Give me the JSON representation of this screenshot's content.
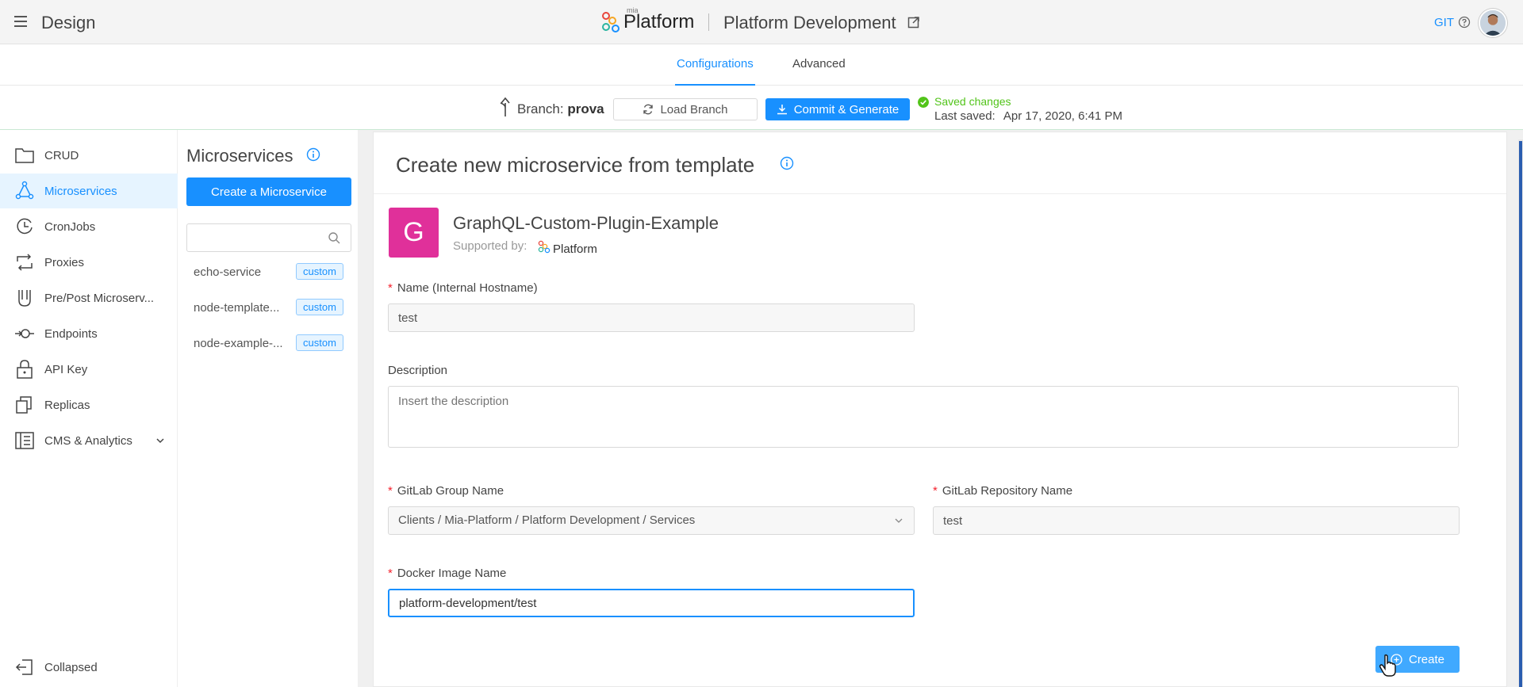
{
  "header": {
    "app_title": "Design",
    "logo_small": "mia",
    "logo_text": "Platform",
    "project_name": "Platform Development",
    "git_label": "GIT"
  },
  "tabs": [
    {
      "label": "Configurations",
      "active": true
    },
    {
      "label": "Advanced",
      "active": false
    }
  ],
  "branch": {
    "prefix": "Branch:",
    "name": "prova",
    "load_label": "Load Branch",
    "commit_label": "Commit & Generate",
    "saved_status": "Saved changes",
    "last_saved_label": "Last saved:",
    "last_saved_value": "Apr 17, 2020, 6:41 PM"
  },
  "sidebar": {
    "items": [
      {
        "label": "CRUD",
        "icon": "folder-icon",
        "active": false
      },
      {
        "label": "Microservices",
        "icon": "microservices-icon",
        "active": true
      },
      {
        "label": "CronJobs",
        "icon": "clock-icon",
        "active": false
      },
      {
        "label": "Proxies",
        "icon": "proxy-icon",
        "active": false
      },
      {
        "label": "Pre/Post Microserv...",
        "icon": "hook-icon",
        "active": false
      },
      {
        "label": "Endpoints",
        "icon": "endpoint-icon",
        "active": false
      },
      {
        "label": "API Key",
        "icon": "lock-icon",
        "active": false
      },
      {
        "label": "Replicas",
        "icon": "copy-icon",
        "active": false
      },
      {
        "label": "CMS & Analytics",
        "icon": "cms-icon",
        "active": false
      }
    ],
    "collapse_label": "Collapsed"
  },
  "microservices": {
    "title": "Microservices",
    "create_label": "Create a Microservice",
    "search_placeholder": "",
    "list": [
      {
        "name": "echo-service",
        "tag": "custom"
      },
      {
        "name": "node-template...",
        "tag": "custom"
      },
      {
        "name": "node-example-...",
        "tag": "custom"
      }
    ]
  },
  "form": {
    "title": "Create new microservice from template",
    "template_initial": "G",
    "template_name": "GraphQL-Custom-Plugin-Example",
    "supported_by": "Supported by:",
    "supported_logo_text": "Platform",
    "name_label": "Name (Internal Hostname)",
    "name_value": "test",
    "description_label": "Description",
    "description_placeholder": "Insert the description",
    "gitlab_group_label": "GitLab Group Name",
    "gitlab_group_value": "Clients / Mia-Platform / Platform Development / Services",
    "gitlab_repo_label": "GitLab Repository Name",
    "gitlab_repo_value": "test",
    "docker_label": "Docker Image Name",
    "docker_value": "platform-development/test",
    "create_label": "Create"
  },
  "colors": {
    "primary": "#1890ff",
    "success": "#52c41a",
    "template_accent": "#e0309a",
    "required": "#f5222d"
  }
}
